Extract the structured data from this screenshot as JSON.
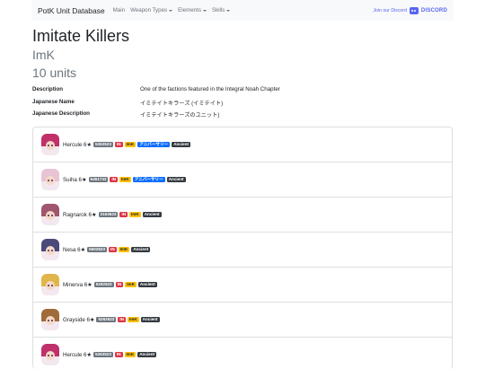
{
  "nav": {
    "brand": "PotK Unit Database",
    "links": [
      {
        "label": "Main",
        "dropdown": false
      },
      {
        "label": "Weapon Types",
        "dropdown": true
      },
      {
        "label": "Elements",
        "dropdown": true
      },
      {
        "label": "Skills",
        "dropdown": true
      }
    ],
    "discord_join": "Join our Discord",
    "discord_word": "DISCORD"
  },
  "page": {
    "title": "Imitate Killers",
    "abbrev": "ImK",
    "count": "10 units"
  },
  "info": [
    {
      "label": "Description",
      "value": "One of the factions featured in the Integral Noah Chapter"
    },
    {
      "label": "Japanese Name",
      "value": "イミテイトキラーズ (イミテイト)"
    },
    {
      "label": "Japanese Description",
      "value": "イミテイトキラーズのユニット)"
    }
  ],
  "units": [
    {
      "name": "Hercule 6★",
      "stats": "5262523",
      "element": "IN",
      "faction": "ImK",
      "anniversary": "アニバーサリー",
      "tag": "Ancient",
      "hair": "#c0306a"
    },
    {
      "name": "Suiha 6★",
      "stats": "5461733",
      "element": "IN",
      "faction": "ImK",
      "anniversary": "アニバーサリー",
      "tag": "Ancient",
      "hair": "#e8c3d3"
    },
    {
      "name": "Ragnarok 6★",
      "stats": "3163623",
      "element": "IN",
      "faction": "ImK",
      "anniversary": "",
      "tag": "Ancient",
      "hair": "#a0566e"
    },
    {
      "name": "Nesa 6★",
      "stats": "5602623",
      "element": "IN",
      "faction": "ImK",
      "anniversary": "",
      "tag": "Ancient",
      "hair": "#4a4a7a"
    },
    {
      "name": "Minerva 6★",
      "stats": "5262523",
      "element": "IN",
      "faction": "ImK",
      "anniversary": "",
      "tag": "Ancient",
      "hair": "#e2b54a"
    },
    {
      "name": "Grayside 6★",
      "stats": "5262623",
      "element": "IN",
      "faction": "ImK",
      "anniversary": "",
      "tag": "Ancient",
      "hair": "#a06a3a"
    },
    {
      "name": "Hercule 6★",
      "stats": "5262523",
      "element": "IN",
      "faction": "ImK",
      "anniversary": "",
      "tag": "Ancient",
      "hair": "#c0306a"
    }
  ]
}
